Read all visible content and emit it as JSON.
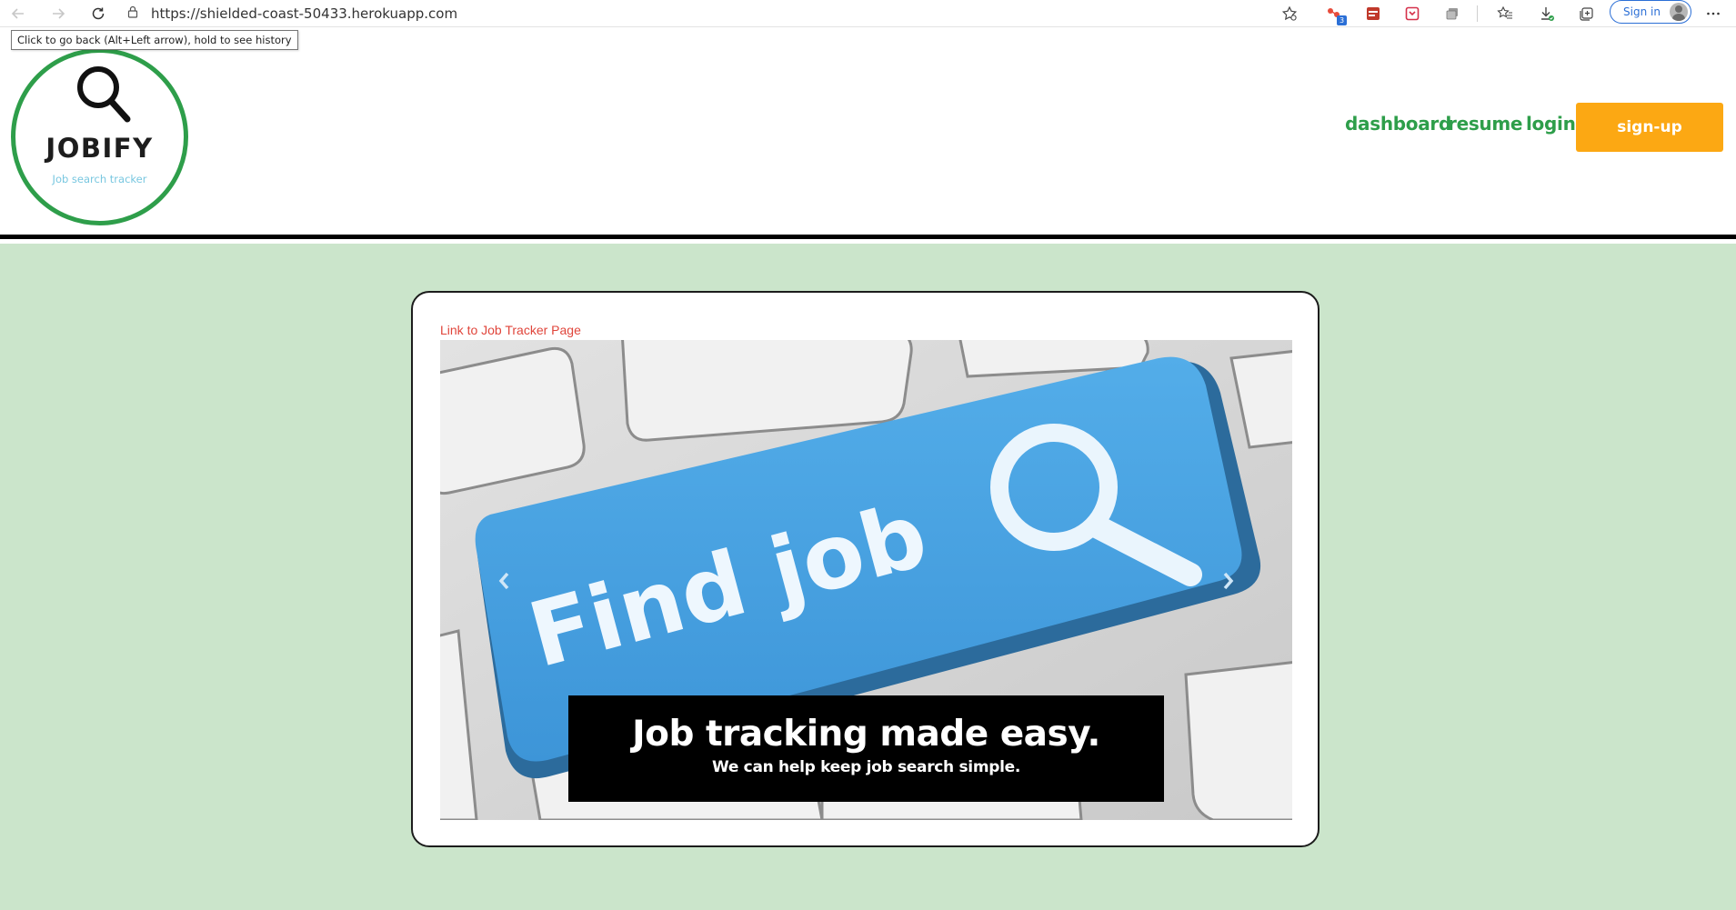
{
  "browser": {
    "url": "https://shielded-coast-50433.herokuapp.com",
    "signin_label": "Sign in",
    "extension_badge": "3",
    "tooltip": "Click to go back (Alt+Left arrow), hold to see history",
    "icons": [
      "back-icon",
      "forward-icon",
      "refresh-icon",
      "lock-icon",
      "favorite-add-icon",
      "extension-icon",
      "pdf-icon",
      "pocket-icon",
      "tab-actions-icon",
      "favorites-icon",
      "downloads-icon",
      "collections-icon",
      "avatar-icon",
      "more-icon"
    ]
  },
  "header": {
    "logo_title": "JOBIFY",
    "logo_subtitle": "Job search tracker",
    "nav": {
      "dashboard": "dashboard",
      "resume": "resume",
      "login": "login",
      "signup": "sign-up"
    }
  },
  "main": {
    "tracker_link": "Link to Job Tracker Page",
    "carousel": {
      "slide_key_text": "Find job",
      "caption_title": "Job tracking made easy.",
      "caption_subtitle": "We can help keep job search simple."
    }
  },
  "colors": {
    "brand_green": "#2e9e4a",
    "signup_orange": "#fca813",
    "page_background": "#cbe5cb",
    "link_red": "#e0453b",
    "key_blue": "#4aa3e3"
  }
}
